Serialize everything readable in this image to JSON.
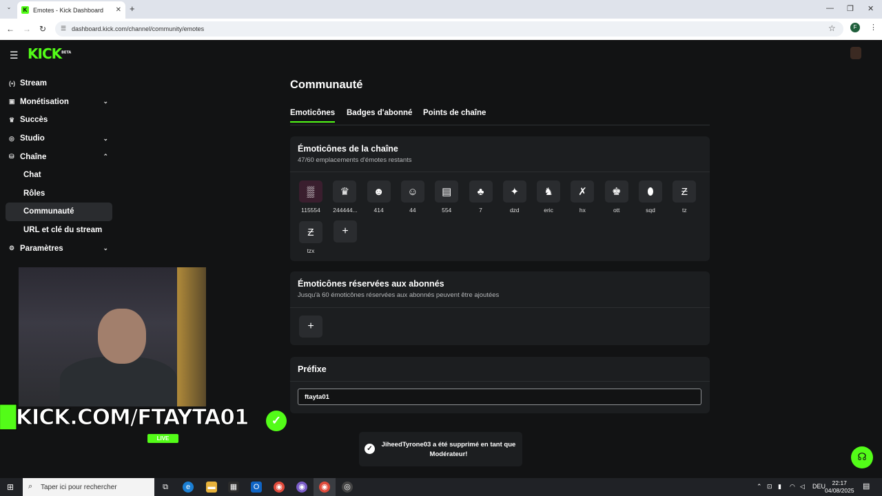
{
  "browser": {
    "tab_title": "Emotes - Kick Dashboard",
    "url": "dashboard.kick.com/channel/community/emotes",
    "profile_initial": "F"
  },
  "brand": {
    "logo": "KICK",
    "beta": "BETA",
    "accent": "#53fc18"
  },
  "sidebar": {
    "items": [
      {
        "label": "Stream",
        "icon": "broadcast-icon"
      },
      {
        "label": "Monétisation",
        "icon": "monetization-icon"
      },
      {
        "label": "Succès",
        "icon": "trophy-icon"
      },
      {
        "label": "Studio",
        "icon": "studio-icon"
      },
      {
        "label": "Chaîne",
        "icon": "channel-icon"
      },
      {
        "label": "Chat"
      },
      {
        "label": "Rôles"
      },
      {
        "label": "Communauté"
      },
      {
        "label": "URL et clé du stream"
      },
      {
        "label": "Paramètres",
        "icon": "gear-icon"
      }
    ]
  },
  "main": {
    "title": "Communauté",
    "tabs": [
      "Emoticônes",
      "Badges d'abonné",
      "Points de chaîne"
    ],
    "channel_emotes": {
      "title": "Émoticônes de la chaîne",
      "subtitle": "47/60 emplacements d'émotes restants",
      "emotes": [
        "115554",
        "244444...",
        "414",
        "44",
        "554",
        "7",
        "dzd",
        "eric",
        "hx",
        "ott",
        "sqd",
        "tz",
        "tzx"
      ]
    },
    "sub_emotes": {
      "title": "Émoticônes réservées aux abonnés",
      "subtitle": "Jusqu'à 60 émoticônes réservées aux abonnés peuvent être ajoutées"
    },
    "prefix": {
      "title": "Préfixe",
      "value": "ftayta01"
    }
  },
  "toast": {
    "message": "JiheedTyrone03 a été supprimé en tant que Modérateur!"
  },
  "overlay": {
    "text": "KICK.COM/FTAYTA01",
    "live": "LIVE"
  },
  "taskbar": {
    "search_placeholder": "Taper ici pour rechercher",
    "lang": "DEU",
    "time": "22:17",
    "date": "04/08/2025"
  }
}
